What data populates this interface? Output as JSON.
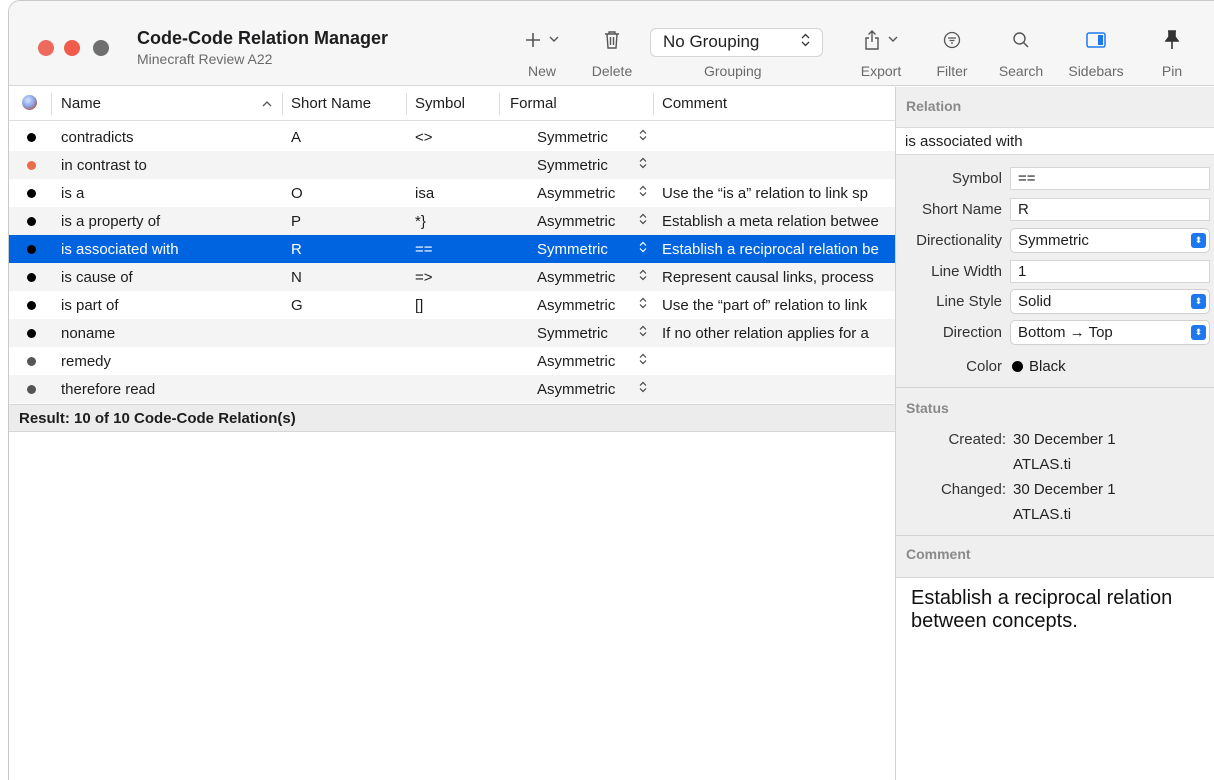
{
  "window": {
    "title": "Code-Code Relation Manager",
    "subtitle": "Minecraft Review A22"
  },
  "toolbar": {
    "new_label": "New",
    "delete_label": "Delete",
    "grouping_value": "No Grouping",
    "grouping_label": "Grouping",
    "export_label": "Export",
    "filter_label": "Filter",
    "search_label": "Search",
    "sidebars_label": "Sidebars",
    "pin_label": "Pin",
    "icons": [
      "plus-icon",
      "trash-icon",
      "share-icon",
      "filter-icon",
      "search-icon",
      "sidebar-icon",
      "pin-icon"
    ]
  },
  "table": {
    "headers": {
      "name": "Name",
      "short_name": "Short Name",
      "symbol": "Symbol",
      "formal": "Formal",
      "comment": "Comment"
    },
    "rows": [
      {
        "color": "#000000",
        "name": "contradicts",
        "short": "A",
        "symbol": "<>",
        "formal": "Symmetric",
        "comment": ""
      },
      {
        "color": "#ef6a4b",
        "name": "in contrast to",
        "short": "",
        "symbol": "",
        "formal": "Symmetric",
        "comment": ""
      },
      {
        "color": "#000000",
        "name": "is a",
        "short": "O",
        "symbol": "isa",
        "formal": "Asymmetric",
        "comment": "Use the “is a” relation to link sp"
      },
      {
        "color": "#000000",
        "name": "is a property of",
        "short": "P",
        "symbol": "*}",
        "formal": "Asymmetric",
        "comment": "Establish a meta relation betwee"
      },
      {
        "color": "#000000",
        "name": "is associated with",
        "short": "R",
        "symbol": "==",
        "formal": "Symmetric",
        "comment": "Establish a reciprocal relation be"
      },
      {
        "color": "#000000",
        "name": "is cause of",
        "short": "N",
        "symbol": "=>",
        "formal": "Asymmetric",
        "comment": "Represent causal links, process"
      },
      {
        "color": "#000000",
        "name": "is part of",
        "short": "G",
        "symbol": "[]",
        "formal": "Asymmetric",
        "comment": "Use the “part of” relation to link"
      },
      {
        "color": "#000000",
        "name": "noname",
        "short": "",
        "symbol": "",
        "formal": "Symmetric",
        "comment": "If no other relation applies for a"
      },
      {
        "color": "#555555",
        "name": "remedy",
        "short": "",
        "symbol": "",
        "formal": "Asymmetric",
        "comment": ""
      },
      {
        "color": "#555555",
        "name": "therefore read",
        "short": "",
        "symbol": "",
        "formal": "Asymmetric",
        "comment": ""
      }
    ],
    "selected_index": 4,
    "result_text": "Result: 10 of 10 Code-Code Relation(s)"
  },
  "sidebar": {
    "relation_title": "Relation",
    "relation_name": "is associated with",
    "symbol_label": "Symbol",
    "symbol_value": "==",
    "short_name_label": "Short Name",
    "short_name_value": "R",
    "directionality_label": "Directionality",
    "directionality_value": "Symmetric",
    "line_width_label": "Line Width",
    "line_width_value": "1",
    "line_style_label": "Line Style",
    "line_style_value": "Solid",
    "direction_label": "Direction",
    "direction_value": "Bottom → Top",
    "color_label": "Color",
    "color_value": "Black",
    "status_title": "Status",
    "created_label": "Created:",
    "created_date": "30 December 1",
    "created_by": "ATLAS.ti",
    "changed_label": "Changed:",
    "changed_date": "30 December 1",
    "changed_by": "ATLAS.ti",
    "comment_title": "Comment",
    "comment_text": "Establish a reciprocal relation between concepts."
  },
  "colors": {
    "selection": "#0064e1",
    "accent": "#1d78f0"
  }
}
